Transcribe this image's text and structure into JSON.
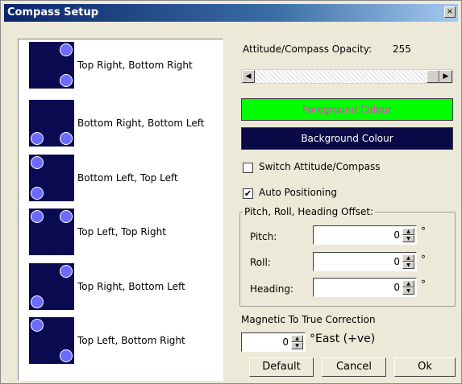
{
  "window": {
    "title": "Compass Setup",
    "close_glyph": "×"
  },
  "list": {
    "items": [
      {
        "label": "Top Right, Bottom Right",
        "positions": [
          "top-right",
          "bottom-right"
        ]
      },
      {
        "label": "Bottom Right, Bottom Left",
        "positions": [
          "bottom-right",
          "bottom-left"
        ]
      },
      {
        "label": "Bottom Left, Top Left",
        "positions": [
          "bottom-left",
          "top-left"
        ]
      },
      {
        "label": "Top Left, Top Right",
        "positions": [
          "top-left",
          "top-right"
        ]
      },
      {
        "label": "Top Right, Bottom Left",
        "positions": [
          "top-right",
          "bottom-left"
        ]
      },
      {
        "label": "Top Left, Bottom Right",
        "positions": [
          "top-left",
          "bottom-right"
        ]
      }
    ]
  },
  "opacity": {
    "label": "Attitude/Compass Opacity:",
    "value": "255",
    "level_fraction": 1.0
  },
  "scrollbar": {
    "left_glyph": "◀",
    "right_glyph": "▶"
  },
  "foreground": {
    "label": "Foreground Colour",
    "bg_color": "#00ff00",
    "text_color": "#ff33cc"
  },
  "background": {
    "label": "Background Colour",
    "bg_color": "#0a0a46",
    "text_color": "#ffffff"
  },
  "switch_attitude": {
    "label": "Switch Attitude/Compass",
    "checked": false,
    "mark": ""
  },
  "auto_positioning": {
    "label": "Auto Positioning",
    "checked": true,
    "mark": "✔"
  },
  "offset_group": {
    "legend": "Pitch, Roll, Heading Offset:",
    "pitch": {
      "label": "Pitch:",
      "value": "0",
      "unit": "°"
    },
    "roll": {
      "label": "Roll:",
      "value": "0",
      "unit": "°"
    },
    "heading": {
      "label": "Heading:",
      "value": "0",
      "unit": "°"
    }
  },
  "magnetic": {
    "label": "Magnetic To True Correction",
    "value": "0",
    "unit": "°East (+ve)"
  },
  "spin_glyphs": {
    "up": "▲",
    "down": "▼"
  },
  "buttons": {
    "default": "Default",
    "cancel": "Cancel",
    "ok": "Ok"
  }
}
